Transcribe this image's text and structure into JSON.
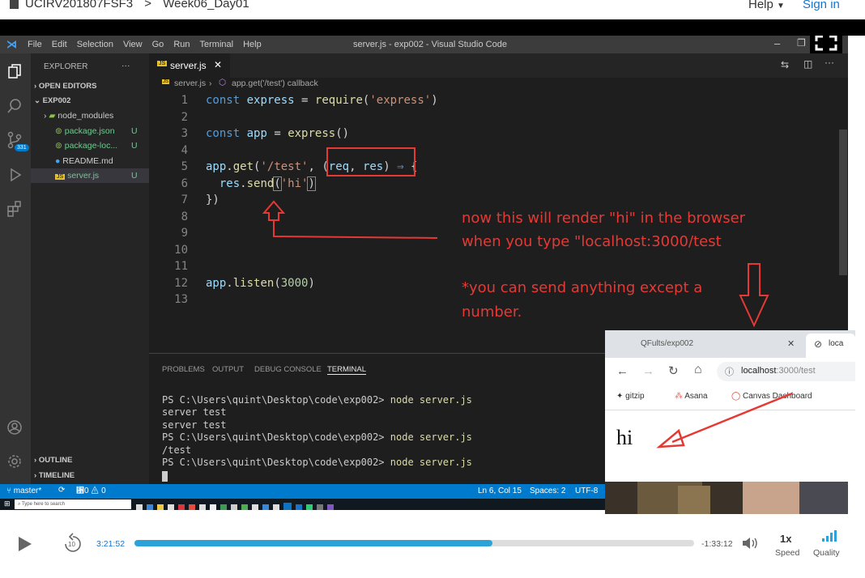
{
  "site": {
    "course": "UCIRV201807FSF3",
    "separator": ">",
    "lesson": "Week06_Day01",
    "help": "Help",
    "signin": "Sign in"
  },
  "vscode": {
    "menu": [
      "File",
      "Edit",
      "Selection",
      "View",
      "Go",
      "Run",
      "Terminal",
      "Help"
    ],
    "window_title": "server.js - exp002 - Visual Studio Code",
    "activity_badge": "331",
    "explorer_title": "EXPLORER",
    "open_editors": "OPEN EDITORS",
    "project": "EXP002",
    "files": [
      {
        "name": "node_modules",
        "status": ""
      },
      {
        "name": "package.json",
        "status": "U"
      },
      {
        "name": "package-loc...",
        "status": "U"
      },
      {
        "name": "README.md",
        "status": ""
      },
      {
        "name": "server.js",
        "status": "U"
      }
    ],
    "outline": "OUTLINE",
    "timeline": "TIMELINE",
    "tab": "server.js",
    "breadcrumb_file": "server.js",
    "breadcrumb_symbol": "app.get('/test') callback",
    "line_numbers": [
      "1",
      "2",
      "3",
      "4",
      "5",
      "6",
      "7",
      "8",
      "9",
      "10",
      "11",
      "12",
      "13"
    ],
    "panel_tabs": [
      "PROBLEMS",
      "OUTPUT",
      "DEBUG CONSOLE",
      "TERMINAL"
    ],
    "terminal": [
      {
        "prompt": "PS C:\\Users\\quint\\Desktop\\code\\exp002> ",
        "cmd": "node server.js"
      },
      {
        "prompt": "server test",
        "cmd": ""
      },
      {
        "prompt": "server test",
        "cmd": ""
      },
      {
        "prompt": "PS C:\\Users\\quint\\Desktop\\code\\exp002> ",
        "cmd": "node server.js"
      },
      {
        "prompt": "/test",
        "cmd": ""
      },
      {
        "prompt": "PS C:\\Users\\quint\\Desktop\\code\\exp002> ",
        "cmd": "node server.js"
      }
    ],
    "status_branch": "master*",
    "status_problems": "␸0 ⚠ 0",
    "status_position": "Ln 6, Col 15",
    "status_spaces": "Spaces: 2",
    "status_encoding": "UTF-8",
    "taskbar_search": "Type here to search"
  },
  "annotation": {
    "line1": "now this will render \"hi\" in the browser",
    "line2": "when you type \"localhost:3000/test",
    "line3": "*you can send anything except a",
    "line4": "number.",
    "color": "#e53935"
  },
  "browser": {
    "tab1": "QFults/exp002",
    "tab2": "loca",
    "url_host": "localhost",
    "url_path": ":3000/test",
    "bookmarks": [
      "gitzip",
      "Asana",
      "Canvas Dashboard"
    ],
    "body_text": "hi"
  },
  "player": {
    "elapsed": "3:21:52",
    "remaining": "-1:33:12",
    "progress_percent": 64,
    "rewind_seconds": "10",
    "speed_value": "1x",
    "speed_label": "Speed",
    "quality_label": "Quality"
  }
}
